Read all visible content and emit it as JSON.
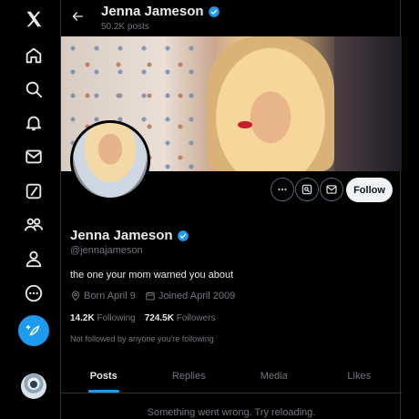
{
  "nav": {
    "items": [
      "x-logo-icon",
      "home-icon",
      "search-icon",
      "notifications-icon",
      "messages-icon",
      "grok-icon",
      "communities-icon",
      "profile-icon",
      "more-icon"
    ],
    "post_icon": "feather-plus-icon"
  },
  "header": {
    "name": "Jenna Jameson",
    "posts": "50.2K posts"
  },
  "profile": {
    "name": "Jenna Jameson",
    "handle": "@jennajameson",
    "bio": "the one your mom warned you about",
    "born": "Born April 9",
    "joined": "Joined April 2009",
    "following_count": "14.2K",
    "following_label": "Following",
    "followers_count": "724.5K",
    "followers_label": "Followers",
    "not_followed": "Not followed by anyone you're following",
    "follow_label": "Follow"
  },
  "tabs": [
    "Posts",
    "Replies",
    "Media",
    "Likes"
  ],
  "error_text": "Something went wrong. Try reloading.",
  "colors": {
    "accent": "#1d9bf0",
    "background": "#000000",
    "muted": "#71767b"
  }
}
